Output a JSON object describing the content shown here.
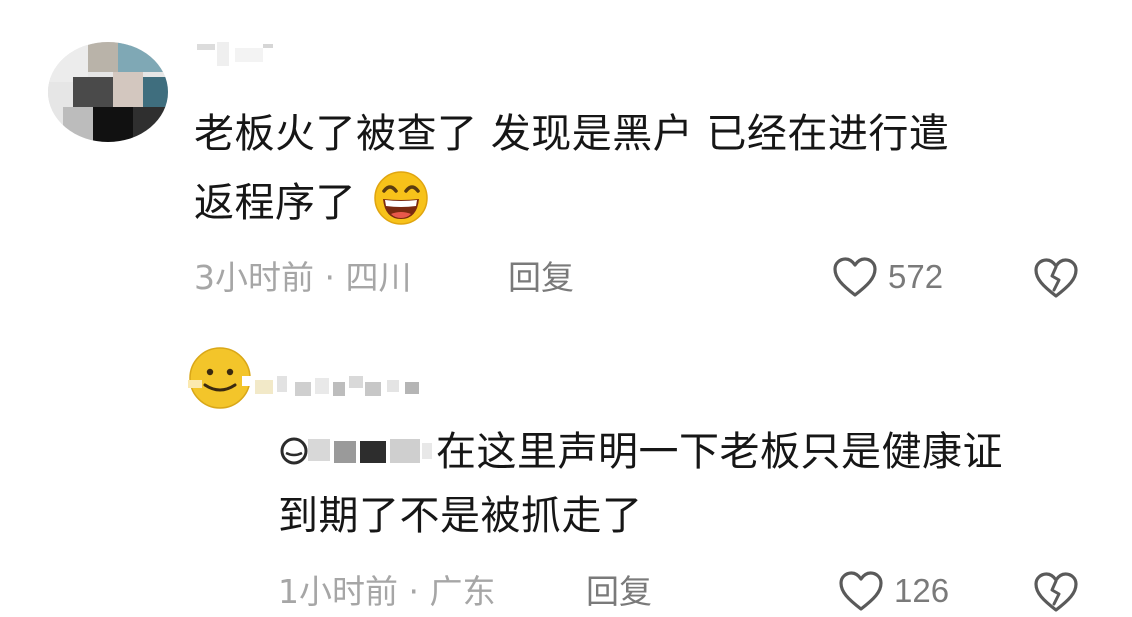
{
  "comment": {
    "text_line1": "老板火了被查了 发现是黑户 已经在进行遣",
    "text_line2": "返程序了",
    "emoji": "laughing-emoji",
    "meta": "3小时前 · 四川",
    "reply_label": "回复",
    "likes": "572",
    "like_icon": "heart-outline-icon",
    "dislike_icon": "broken-heart-icon"
  },
  "reply": {
    "text_line1_rest": "在这里声明一下老板只是健康证",
    "text_line2": "到期了不是被抓走了",
    "meta": "1小时前 · 广东",
    "reply_label": "回复",
    "likes": "126",
    "avatar_icon": "yellow-smiley-avatar"
  },
  "colors": {
    "text": "#161616",
    "meta": "#a6a6a6",
    "action": "#7a7a7a",
    "emoji_yellow": "#f7c21a",
    "avatar_yellow": "#f3c52a"
  }
}
